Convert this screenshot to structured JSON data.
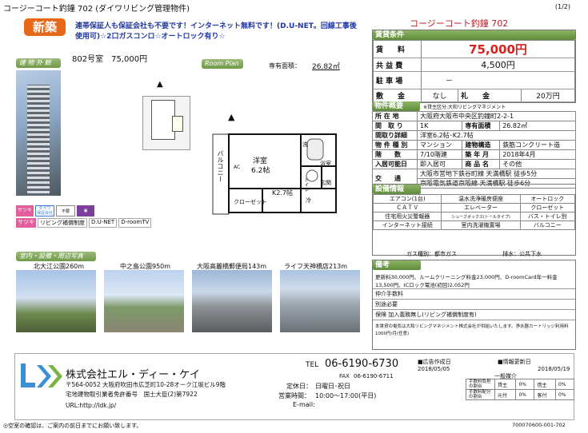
{
  "header": {
    "title": "コージーコート釣鐘 702 (ダイワリビング管理物件)",
    "page": "(1/2)"
  },
  "badge": "新築",
  "catch_copy": "連帯保証人も保証会社も不要です！インターネット無料です！(D.U-NET。回線工事後使用可)☆2口ガスコンロ☆オートロック有り☆",
  "sections": {
    "exterior": "建 物 外 観",
    "room_plan": "Room Plan",
    "amenities": "室内・設備・周辺写真"
  },
  "room": {
    "label": "802号室　75,000円",
    "area_label": "専有面積：",
    "area_value": "26.82㎡"
  },
  "features": {
    "tags": [
      "サツキ",
      "リビング補償制度",
      "D.U-NET",
      "D-roomTV"
    ],
    "tag_small": [
      "ダイワ",
      "保証会社",
      "不要"
    ]
  },
  "floorplan": {
    "balcony": "バルコニー",
    "western": "洋室",
    "western_size": "6.2帖",
    "kitchen": "K2.7帖",
    "closet": "クローゼット",
    "wash": "洗",
    "bath": "浴室",
    "toilet": "トイレ",
    "entrance": "玄関",
    "refrig": "冷",
    "ac": "AC"
  },
  "listing_title": "コージーコート釣鐘 702",
  "terms": {
    "heading": "賃貸条件",
    "rent_label": "賃　　料",
    "rent_value": "75,000円",
    "common_label": "共 益 費",
    "common_value": "4,500円",
    "parking_label": "駐 車 場",
    "parking_value": "－",
    "deposit_label": "敷　　金",
    "deposit_value": "なし",
    "key_label": "礼　　金",
    "key_value": "20万円"
  },
  "overview": {
    "heading": "物件概要",
    "lender": "※貸主区分:大和リビングマネジメント",
    "rows": [
      [
        "所 在 地",
        "大阪府大阪市中央区釣鐘町2-2-1"
      ],
      [
        "間　取 り",
        "1K",
        "専有面積",
        "26.82㎡"
      ],
      [
        "間取り詳細",
        "洋室6.2帖･K2.7帖"
      ],
      [
        "物 件 種 別",
        "マンション",
        "建物構造",
        "鉄筋コンクリート造"
      ],
      [
        "階　　数",
        "7/10階建",
        "築 年 月",
        "2018年4月"
      ],
      [
        "入居可能日",
        "即入居可",
        "商 品 名",
        "その他"
      ],
      [
        "交　　通",
        "大阪市営地下鉄谷町線 天満橋駅 徒歩5分",
        "京阪電気鉄道京阪線 天満橋駅 徒歩6分"
      ]
    ]
  },
  "equipment": {
    "heading": "設備情報",
    "rows": [
      [
        "エアコン(1台)",
        "温水洗浄暖房便座",
        "オートロック"
      ],
      [
        "ＣＡＴＶ",
        "エレベーター",
        "クローゼット"
      ],
      [
        "住宅用火災警報器",
        "シューズボックス(トールタイプ)",
        "バス・トイレ別"
      ],
      [
        "インターネット接続",
        "室内洗濯機置場",
        "バルコニー"
      ]
    ],
    "gas_label": "ガス種別：都市ガス",
    "water_label": "排水：公共下水"
  },
  "remarks": {
    "heading": "備考",
    "lines": [
      "更新料30,000円、ルームクリーニング料金23,000円、D-roomCard年一料金",
      "13,500円、ICロック電池(初回)2,052円"
    ],
    "insurance_label": "仲介手数料",
    "insurance_value": "別途必要",
    "insurance2_label": "加入義務無し(リビング補償制度有)",
    "insurance2_prefix": "保険",
    "note": "本賃貸の電気は大和リビングマネジメント株式会社が供給いたします。浄水器カートリッジ利用料1000円/月(任意)"
  },
  "photos": [
    {
      "label": "北大江公園260m"
    },
    {
      "label": "中之島公園950m"
    },
    {
      "label": "大阪高麗橋郵便局143m"
    },
    {
      "label": "ライフ天神橋店213m"
    }
  ],
  "company": {
    "logo": "LDK",
    "name": "株式会社エル・ディー・ケイ",
    "address": "〒564-0052 大阪府吹田市広芝町10-28オーク江坂ビル9階",
    "license": "宅地建物取引業者免許番号　国土大臣(2)第7922",
    "url": "URL:http://ldk.jp/"
  },
  "contact": {
    "tel_label": "TEL",
    "tel": "06-6190-6730",
    "fax_label": "FAX",
    "fax": "06-6190-6711",
    "holiday_label": "定休日：",
    "holiday": "日曜日･祝日",
    "hours_label": "営業時間：",
    "hours": "10:00～17:00(平日)",
    "email_label": "E-mail:"
  },
  "dates": {
    "ad_label": "広告作成日",
    "ad_date": "2018/05/05",
    "update_label": "情報更新日",
    "update_date": "2018/05/19",
    "general": "一般媒介"
  },
  "shares": [
    {
      "label": "手数料負担の割合",
      "left_label": "貸主",
      "left": "0%",
      "right_label": "借主",
      "right": "0%"
    },
    {
      "label": "手数料配分の割合",
      "left_label": "元付",
      "left": "0%",
      "right_label": "客付",
      "right": "0%"
    }
  ],
  "footnote": "◎空室の確認は、ご案内の前日までにお願い致します。",
  "code": "700070600-001-702"
}
